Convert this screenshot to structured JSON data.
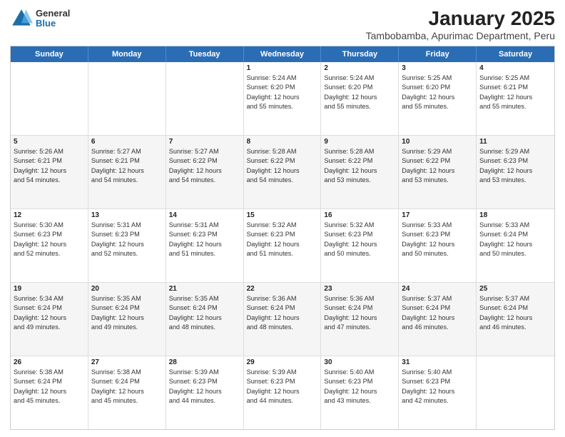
{
  "header": {
    "logo": {
      "general": "General",
      "blue": "Blue"
    },
    "title": "January 2025",
    "subtitle": "Tambobamba, Apurimac Department, Peru"
  },
  "weekdays": [
    "Sunday",
    "Monday",
    "Tuesday",
    "Wednesday",
    "Thursday",
    "Friday",
    "Saturday"
  ],
  "rows": [
    [
      {
        "day": "",
        "info": ""
      },
      {
        "day": "",
        "info": ""
      },
      {
        "day": "",
        "info": ""
      },
      {
        "day": "1",
        "info": "Sunrise: 5:24 AM\nSunset: 6:20 PM\nDaylight: 12 hours\nand 55 minutes."
      },
      {
        "day": "2",
        "info": "Sunrise: 5:24 AM\nSunset: 6:20 PM\nDaylight: 12 hours\nand 55 minutes."
      },
      {
        "day": "3",
        "info": "Sunrise: 5:25 AM\nSunset: 6:20 PM\nDaylight: 12 hours\nand 55 minutes."
      },
      {
        "day": "4",
        "info": "Sunrise: 5:25 AM\nSunset: 6:21 PM\nDaylight: 12 hours\nand 55 minutes."
      }
    ],
    [
      {
        "day": "5",
        "info": "Sunrise: 5:26 AM\nSunset: 6:21 PM\nDaylight: 12 hours\nand 54 minutes."
      },
      {
        "day": "6",
        "info": "Sunrise: 5:27 AM\nSunset: 6:21 PM\nDaylight: 12 hours\nand 54 minutes."
      },
      {
        "day": "7",
        "info": "Sunrise: 5:27 AM\nSunset: 6:22 PM\nDaylight: 12 hours\nand 54 minutes."
      },
      {
        "day": "8",
        "info": "Sunrise: 5:28 AM\nSunset: 6:22 PM\nDaylight: 12 hours\nand 54 minutes."
      },
      {
        "day": "9",
        "info": "Sunrise: 5:28 AM\nSunset: 6:22 PM\nDaylight: 12 hours\nand 53 minutes."
      },
      {
        "day": "10",
        "info": "Sunrise: 5:29 AM\nSunset: 6:22 PM\nDaylight: 12 hours\nand 53 minutes."
      },
      {
        "day": "11",
        "info": "Sunrise: 5:29 AM\nSunset: 6:23 PM\nDaylight: 12 hours\nand 53 minutes."
      }
    ],
    [
      {
        "day": "12",
        "info": "Sunrise: 5:30 AM\nSunset: 6:23 PM\nDaylight: 12 hours\nand 52 minutes."
      },
      {
        "day": "13",
        "info": "Sunrise: 5:31 AM\nSunset: 6:23 PM\nDaylight: 12 hours\nand 52 minutes."
      },
      {
        "day": "14",
        "info": "Sunrise: 5:31 AM\nSunset: 6:23 PM\nDaylight: 12 hours\nand 51 minutes."
      },
      {
        "day": "15",
        "info": "Sunrise: 5:32 AM\nSunset: 6:23 PM\nDaylight: 12 hours\nand 51 minutes."
      },
      {
        "day": "16",
        "info": "Sunrise: 5:32 AM\nSunset: 6:23 PM\nDaylight: 12 hours\nand 50 minutes."
      },
      {
        "day": "17",
        "info": "Sunrise: 5:33 AM\nSunset: 6:23 PM\nDaylight: 12 hours\nand 50 minutes."
      },
      {
        "day": "18",
        "info": "Sunrise: 5:33 AM\nSunset: 6:24 PM\nDaylight: 12 hours\nand 50 minutes."
      }
    ],
    [
      {
        "day": "19",
        "info": "Sunrise: 5:34 AM\nSunset: 6:24 PM\nDaylight: 12 hours\nand 49 minutes."
      },
      {
        "day": "20",
        "info": "Sunrise: 5:35 AM\nSunset: 6:24 PM\nDaylight: 12 hours\nand 49 minutes."
      },
      {
        "day": "21",
        "info": "Sunrise: 5:35 AM\nSunset: 6:24 PM\nDaylight: 12 hours\nand 48 minutes."
      },
      {
        "day": "22",
        "info": "Sunrise: 5:36 AM\nSunset: 6:24 PM\nDaylight: 12 hours\nand 48 minutes."
      },
      {
        "day": "23",
        "info": "Sunrise: 5:36 AM\nSunset: 6:24 PM\nDaylight: 12 hours\nand 47 minutes."
      },
      {
        "day": "24",
        "info": "Sunrise: 5:37 AM\nSunset: 6:24 PM\nDaylight: 12 hours\nand 46 minutes."
      },
      {
        "day": "25",
        "info": "Sunrise: 5:37 AM\nSunset: 6:24 PM\nDaylight: 12 hours\nand 46 minutes."
      }
    ],
    [
      {
        "day": "26",
        "info": "Sunrise: 5:38 AM\nSunset: 6:24 PM\nDaylight: 12 hours\nand 45 minutes."
      },
      {
        "day": "27",
        "info": "Sunrise: 5:38 AM\nSunset: 6:24 PM\nDaylight: 12 hours\nand 45 minutes."
      },
      {
        "day": "28",
        "info": "Sunrise: 5:39 AM\nSunset: 6:23 PM\nDaylight: 12 hours\nand 44 minutes."
      },
      {
        "day": "29",
        "info": "Sunrise: 5:39 AM\nSunset: 6:23 PM\nDaylight: 12 hours\nand 44 minutes."
      },
      {
        "day": "30",
        "info": "Sunrise: 5:40 AM\nSunset: 6:23 PM\nDaylight: 12 hours\nand 43 minutes."
      },
      {
        "day": "31",
        "info": "Sunrise: 5:40 AM\nSunset: 6:23 PM\nDaylight: 12 hours\nand 42 minutes."
      },
      {
        "day": "",
        "info": ""
      }
    ]
  ],
  "shaded_rows": [
    1,
    3
  ]
}
